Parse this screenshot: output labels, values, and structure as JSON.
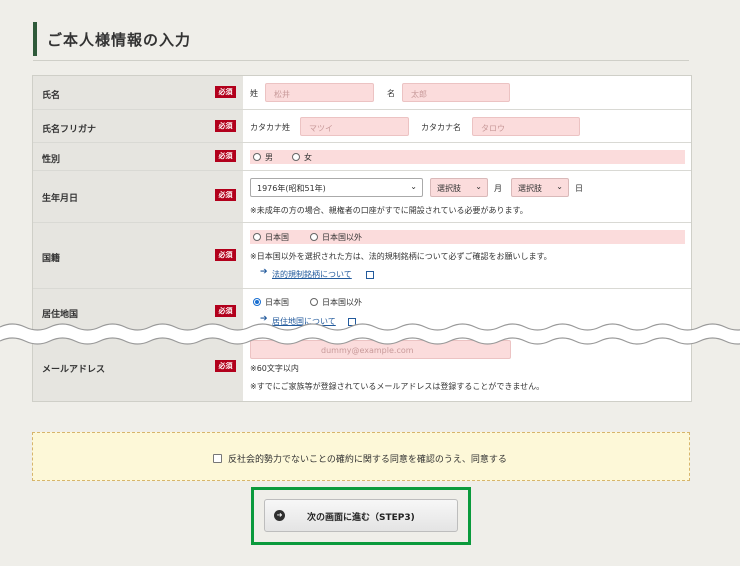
{
  "section_title": "ご本人様情報の入力",
  "required_badge": "必須",
  "fields": {
    "name": {
      "label": "氏名",
      "sei_label": "姓",
      "sei_placeholder": "松井",
      "mei_label": "名",
      "mei_placeholder": "太郎"
    },
    "furigana": {
      "label": "氏名フリガナ",
      "sei_label": "カタカナ姓",
      "sei_placeholder": "マツイ",
      "mei_label": "カタカナ名",
      "mei_placeholder": "タロウ"
    },
    "gender": {
      "label": "性別",
      "options": [
        "男",
        "女"
      ]
    },
    "birthdate": {
      "label": "生年月日",
      "year_value": "1976年(昭和51年)",
      "month_value": "選択肢",
      "month_unit": "月",
      "day_value": "選択肢",
      "day_unit": "日",
      "note": "※未成年の方の場合、親権者の口座がすでに開設されている必要があります。"
    },
    "nationality": {
      "label": "国籍",
      "options": [
        "日本国",
        "日本国以外"
      ],
      "note": "※日本国以外を選択された方は、法的規制銘柄について必ずご確認をお願いします。",
      "link": "法的規制銘柄について"
    },
    "residence": {
      "label": "居住地国",
      "options": [
        "日本国",
        "日本国以外"
      ],
      "selected": "日本国",
      "link": "居住地国について"
    },
    "email": {
      "label": "メールアドレス",
      "placeholder_fragment": "dummy@example.com",
      "limit_note": "※60文字以内",
      "note": "※すでにご家族等が登録されているメールアドレスは登録することができません。"
    }
  },
  "consent": {
    "checked": false,
    "text": "反社会的勢力でないことの確約に関する同意を確認のうえ、同意する"
  },
  "next_button": {
    "label": "次の画面に進む（STEP3)"
  },
  "colors": {
    "accent_green": "#2f5a3a",
    "required_red": "#b2001c",
    "input_pink": "#fbdcdc",
    "highlight_green": "#0a9a3c",
    "notice_yellow": "#fdf8d8"
  }
}
